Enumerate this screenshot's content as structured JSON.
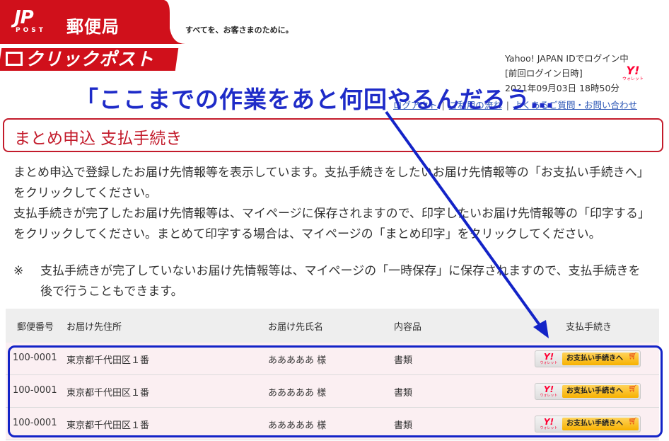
{
  "header": {
    "jp_mark": "JP",
    "jp_sub": "POST",
    "org_name": "郵便局",
    "tagline": "すべてを、お客さまのために。",
    "service_logo": "クリックポスト"
  },
  "login": {
    "line1": "Yahoo! JAPAN IDでログイン中",
    "line2": "[前回ログイン日時]",
    "line3": "2021年09月03日 18時50分",
    "wallet_y": "Y!",
    "wallet_label": "ウォレット"
  },
  "nav": {
    "logout": "ログアウト",
    "flow": "ご利用の流れ",
    "faq": "よくあるご質問・お問い合わせ"
  },
  "annotation": "「ここまでの作業をあと何回やるんだろう…",
  "page_title": "まとめ申込 支払手続き",
  "description": {
    "p1": "まとめ申込で登録したお届け先情報等を表示しています。支払手続きをしたいお届け先情報等の「お支払い手続きへ」をクリックしてください。",
    "p2": "支払手続きが完了したお届け先情報等は、マイページに保存されますので、印字したいお届け先情報等の「印字する」をクリックしてください。まとめて印字する場合は、マイページの「まとめ印字」をクリックしてください。",
    "note_mark": "※",
    "note": "支払手続きが完了していないお届け先情報等は、マイページの「一時保存」に保存されますので、支払手続きを後で行うこともできます。"
  },
  "table": {
    "headers": {
      "postal": "郵便番号",
      "address": "お届け先住所",
      "name": "お届け先氏名",
      "contents": "内容品",
      "payment": "支払手続き"
    },
    "rows": [
      {
        "postal": "100-0001",
        "address": "東京都千代田区１番",
        "name": "あああああ 様",
        "contents": "書類",
        "button": "お支払い手続きへ"
      },
      {
        "postal": "100-0001",
        "address": "東京都千代田区１番",
        "name": "あああああ 様",
        "contents": "書類",
        "button": "お支払い手続きへ"
      },
      {
        "postal": "100-0001",
        "address": "東京都千代田区１番",
        "name": "あああああ 様",
        "contents": "書類",
        "button": "お支払い手続きへ"
      }
    ],
    "button_y": "Y!",
    "button_wallet": "ウォレット"
  },
  "colors": {
    "brand_red": "#d0101b",
    "annotation_blue": "#1e2bc8",
    "row_pink": "#fbeff2",
    "button_orange": "#f7b100"
  }
}
